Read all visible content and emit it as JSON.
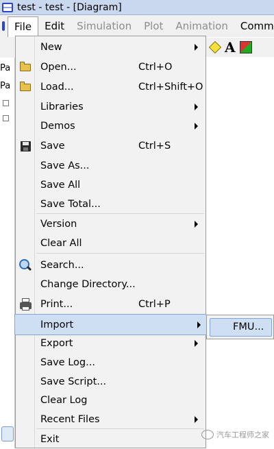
{
  "window": {
    "title": "test - test  - [Diagram]"
  },
  "menubar": {
    "items": [
      {
        "label": "File",
        "state": "active"
      },
      {
        "label": "Edit",
        "state": "normal"
      },
      {
        "label": "Simulation",
        "state": "disabled"
      },
      {
        "label": "Plot",
        "state": "disabled"
      },
      {
        "label": "Animation",
        "state": "disabled"
      },
      {
        "label": "Commar",
        "state": "normal"
      }
    ]
  },
  "toolbar": {
    "text_tool_glyph": "A",
    "icons": [
      "diamond-shape-icon",
      "text-icon",
      "color-icon"
    ]
  },
  "left_panel": {
    "tab1": "Pa",
    "tab2": "Pa"
  },
  "file_menu": {
    "items": [
      {
        "label": "New",
        "shortcut": "",
        "submenu": true,
        "icon": ""
      },
      {
        "label": "Open...",
        "shortcut": "Ctrl+O",
        "submenu": false,
        "icon": "open-folder-icon"
      },
      {
        "label": "Load...",
        "shortcut": "Ctrl+Shift+O",
        "submenu": false,
        "icon": "load-folder-icon"
      },
      {
        "label": "Libraries",
        "shortcut": "",
        "submenu": true,
        "icon": ""
      },
      {
        "label": "Demos",
        "shortcut": "",
        "submenu": true,
        "icon": ""
      },
      {
        "label": "Save",
        "shortcut": "Ctrl+S",
        "submenu": false,
        "icon": "floppy-disk-icon"
      },
      {
        "label": "Save As...",
        "shortcut": "",
        "submenu": false,
        "icon": ""
      },
      {
        "label": "Save All",
        "shortcut": "",
        "submenu": false,
        "icon": ""
      },
      {
        "label": "Save Total...",
        "shortcut": "",
        "submenu": false,
        "icon": ""
      },
      {
        "label": "Version",
        "shortcut": "",
        "submenu": true,
        "icon": ""
      },
      {
        "label": "Clear All",
        "shortcut": "",
        "submenu": false,
        "icon": ""
      },
      {
        "label": "Search...",
        "shortcut": "",
        "submenu": false,
        "icon": "magnifier-icon"
      },
      {
        "label": "Change Directory...",
        "shortcut": "",
        "submenu": false,
        "icon": ""
      },
      {
        "label": "Print...",
        "shortcut": "Ctrl+P",
        "submenu": false,
        "icon": "printer-icon"
      },
      {
        "label": "Import",
        "shortcut": "",
        "submenu": true,
        "icon": "",
        "highlighted": true
      },
      {
        "label": "Export",
        "shortcut": "",
        "submenu": true,
        "icon": ""
      },
      {
        "label": "Save Log...",
        "shortcut": "",
        "submenu": false,
        "icon": ""
      },
      {
        "label": "Save Script...",
        "shortcut": "",
        "submenu": false,
        "icon": ""
      },
      {
        "label": "Clear Log",
        "shortcut": "",
        "submenu": false,
        "icon": ""
      },
      {
        "label": "Recent Files",
        "shortcut": "",
        "submenu": true,
        "icon": ""
      },
      {
        "label": "Exit",
        "shortcut": "",
        "submenu": false,
        "icon": ""
      }
    ]
  },
  "import_submenu": {
    "items": [
      {
        "label": "FMU...",
        "highlighted": true
      }
    ]
  },
  "watermark": {
    "text": "汽车工程师之家"
  },
  "colors": {
    "highlight_bg": "#cfdff3",
    "highlight_border": "#7fa5d9",
    "menu_bg": "#f2f2f2",
    "disabled_text": "#8d8d8d"
  }
}
